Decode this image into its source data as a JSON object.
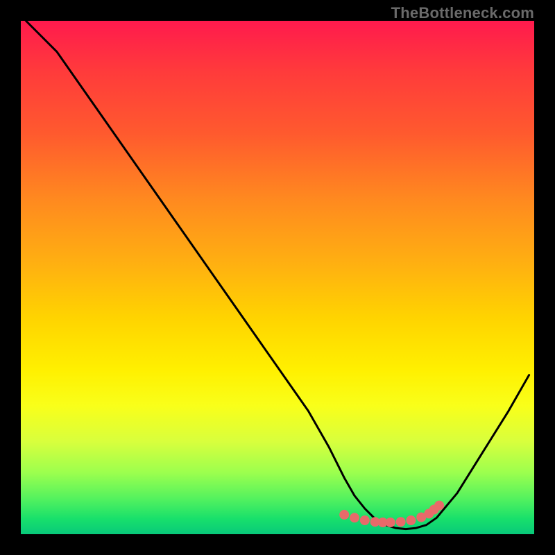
{
  "watermark": "TheBottleneck.com",
  "chart_data": {
    "type": "line",
    "title": "",
    "xlabel": "",
    "ylabel": "",
    "xlim": [
      0,
      100
    ],
    "ylim": [
      0,
      100
    ],
    "grid": false,
    "legend": false,
    "curve": {
      "comment": "V-shaped bottleneck curve. y = distance from optimal (0 = ideal).",
      "x": [
        1,
        7,
        14,
        21,
        28,
        35,
        42,
        49,
        56,
        60,
        63,
        65,
        67,
        69,
        71,
        73,
        75,
        77,
        79,
        81,
        85,
        90,
        95,
        99
      ],
      "y": [
        100,
        94,
        84,
        74,
        64,
        54,
        44,
        34,
        24,
        17,
        11,
        7.5,
        5,
        3,
        1.8,
        1.2,
        1.0,
        1.2,
        1.8,
        3.2,
        8,
        16,
        24,
        31
      ]
    },
    "series": [
      {
        "name": "optimal-range-markers",
        "style": "dots",
        "x": [
          63,
          65,
          67,
          69,
          70.5,
          72,
          74,
          76,
          78,
          79.5,
          80.5,
          81.5
        ],
        "y": [
          3.8,
          3.2,
          2.7,
          2.4,
          2.3,
          2.3,
          2.4,
          2.7,
          3.3,
          4.0,
          4.8,
          5.6
        ]
      }
    ]
  },
  "colors": {
    "dot": "#e86a6a",
    "curve": "#000000"
  }
}
